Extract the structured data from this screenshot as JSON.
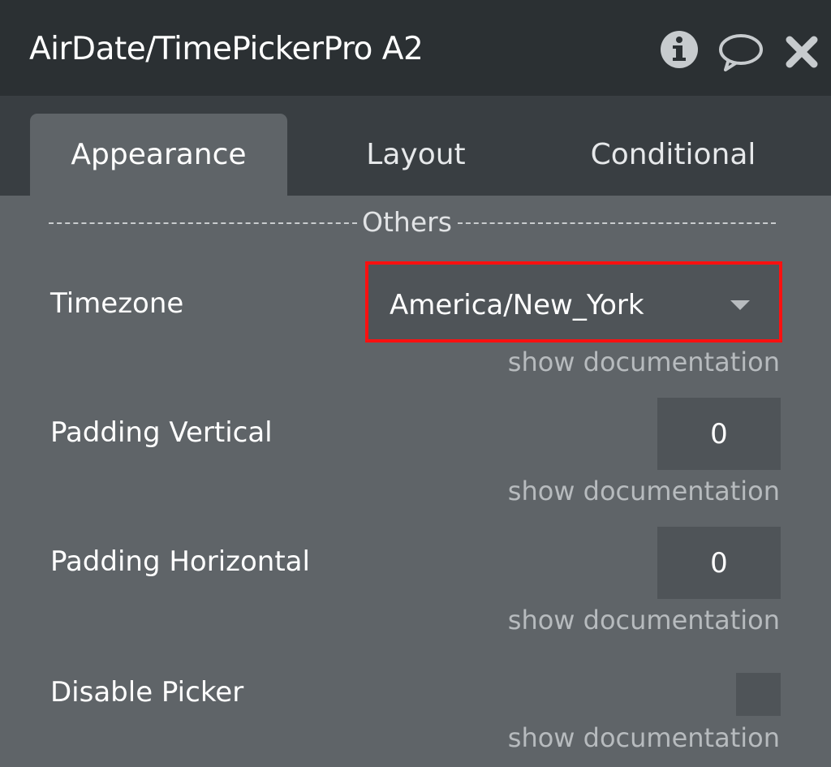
{
  "window": {
    "title": "AirDate/TimePickerPro A2",
    "icons": [
      "info-icon",
      "comment-icon",
      "close-icon"
    ]
  },
  "tabs": [
    {
      "label": "Appearance",
      "active": true
    },
    {
      "label": "Layout",
      "active": false
    },
    {
      "label": "Conditional",
      "active": false
    }
  ],
  "section": {
    "label": "Others"
  },
  "properties": {
    "timezone": {
      "label": "Timezone",
      "value": "America/New_York",
      "doc": "show documentation"
    },
    "padding_vertical": {
      "label": "Padding Vertical",
      "value": "0",
      "doc": "show documentation"
    },
    "padding_horizontal": {
      "label": "Padding Horizontal",
      "value": "0",
      "doc": "show documentation"
    },
    "disable_picker": {
      "label": "Disable Picker",
      "checked": false,
      "doc": "show documentation"
    }
  },
  "colors": {
    "titlebar": "#2b3033",
    "tabstrip": "#393e42",
    "panel": "#5f6468",
    "field": "#4f5458",
    "highlight": "#ff1010"
  }
}
